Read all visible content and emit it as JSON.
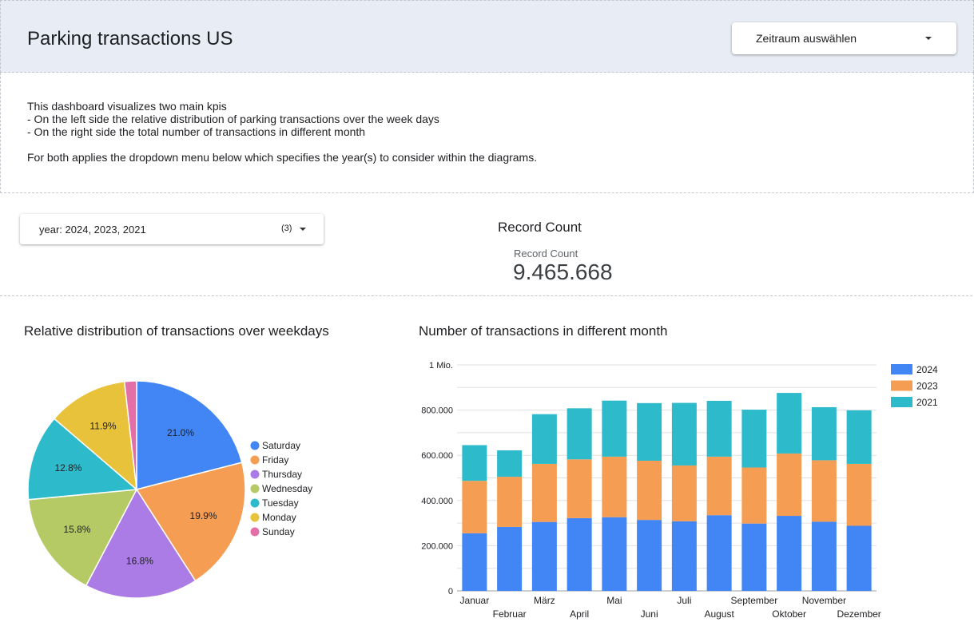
{
  "header": {
    "title": "Parking transactions US",
    "date_dropdown_label": "Zeitraum auswählen"
  },
  "description": {
    "lines": [
      "This dashboard visualizes two main kpis",
      "- On the left side the relative distribution of parking transactions over the week days",
      "- On the right side the total number of transactions in different month",
      "For both applies the dropdown menu below which specifies the year(s) to consider within the diagrams."
    ]
  },
  "filter": {
    "prefix": "year",
    "value": ": 2024, 2023, 2021",
    "count": "(3)"
  },
  "record_count": {
    "title": "Record Count",
    "label": "Record Count",
    "value": "9.465.668"
  },
  "pie": {
    "title": "Relative distribution of transactions over weekdays"
  },
  "bar": {
    "title": "Number of transactions in different month"
  },
  "chart_data": [
    {
      "type": "pie",
      "title": "Relative distribution of transactions over weekdays",
      "labels": [
        "Saturday",
        "Friday",
        "Thursday",
        "Wednesday",
        "Tuesday",
        "Monday",
        "Sunday"
      ],
      "values": [
        21.0,
        19.9,
        16.8,
        15.8,
        12.8,
        11.9,
        1.8
      ],
      "value_labels": [
        "21.0%",
        "19.9%",
        "16.8%",
        "15.8%",
        "12.8%",
        "11.9%",
        ""
      ],
      "colors": [
        "#4285f4",
        "#f59d52",
        "#ab7ce6",
        "#b5c965",
        "#2dbacb",
        "#e9c23b",
        "#e46fa8"
      ],
      "legend": "right"
    },
    {
      "type": "bar",
      "stacked": true,
      "title": "Number of transactions in different month",
      "categories": [
        "Januar",
        "Februar",
        "März",
        "April",
        "Mai",
        "Juni",
        "Juli",
        "August",
        "September",
        "Oktober",
        "November",
        "Dezember"
      ],
      "series": [
        {
          "name": "2024",
          "color": "#4285f4",
          "values": [
            255000,
            283000,
            305000,
            322000,
            326000,
            314000,
            308000,
            335000,
            298000,
            332000,
            306000,
            288000
          ]
        },
        {
          "name": "2023",
          "color": "#f59d52",
          "values": [
            232000,
            222000,
            257000,
            260000,
            268000,
            262000,
            247000,
            259000,
            248000,
            276000,
            272000,
            274000
          ]
        },
        {
          "name": "2021",
          "color": "#2dbacb",
          "values": [
            158000,
            117000,
            220000,
            226000,
            248000,
            255000,
            277000,
            247000,
            256000,
            268000,
            235000,
            237000
          ]
        }
      ],
      "yticks": [
        "0",
        "200.000",
        "400.000",
        "600.000",
        "800.000",
        "1 Mio."
      ],
      "ylim": [
        0,
        1000000
      ],
      "grid": true,
      "legend": "top-right"
    }
  ]
}
